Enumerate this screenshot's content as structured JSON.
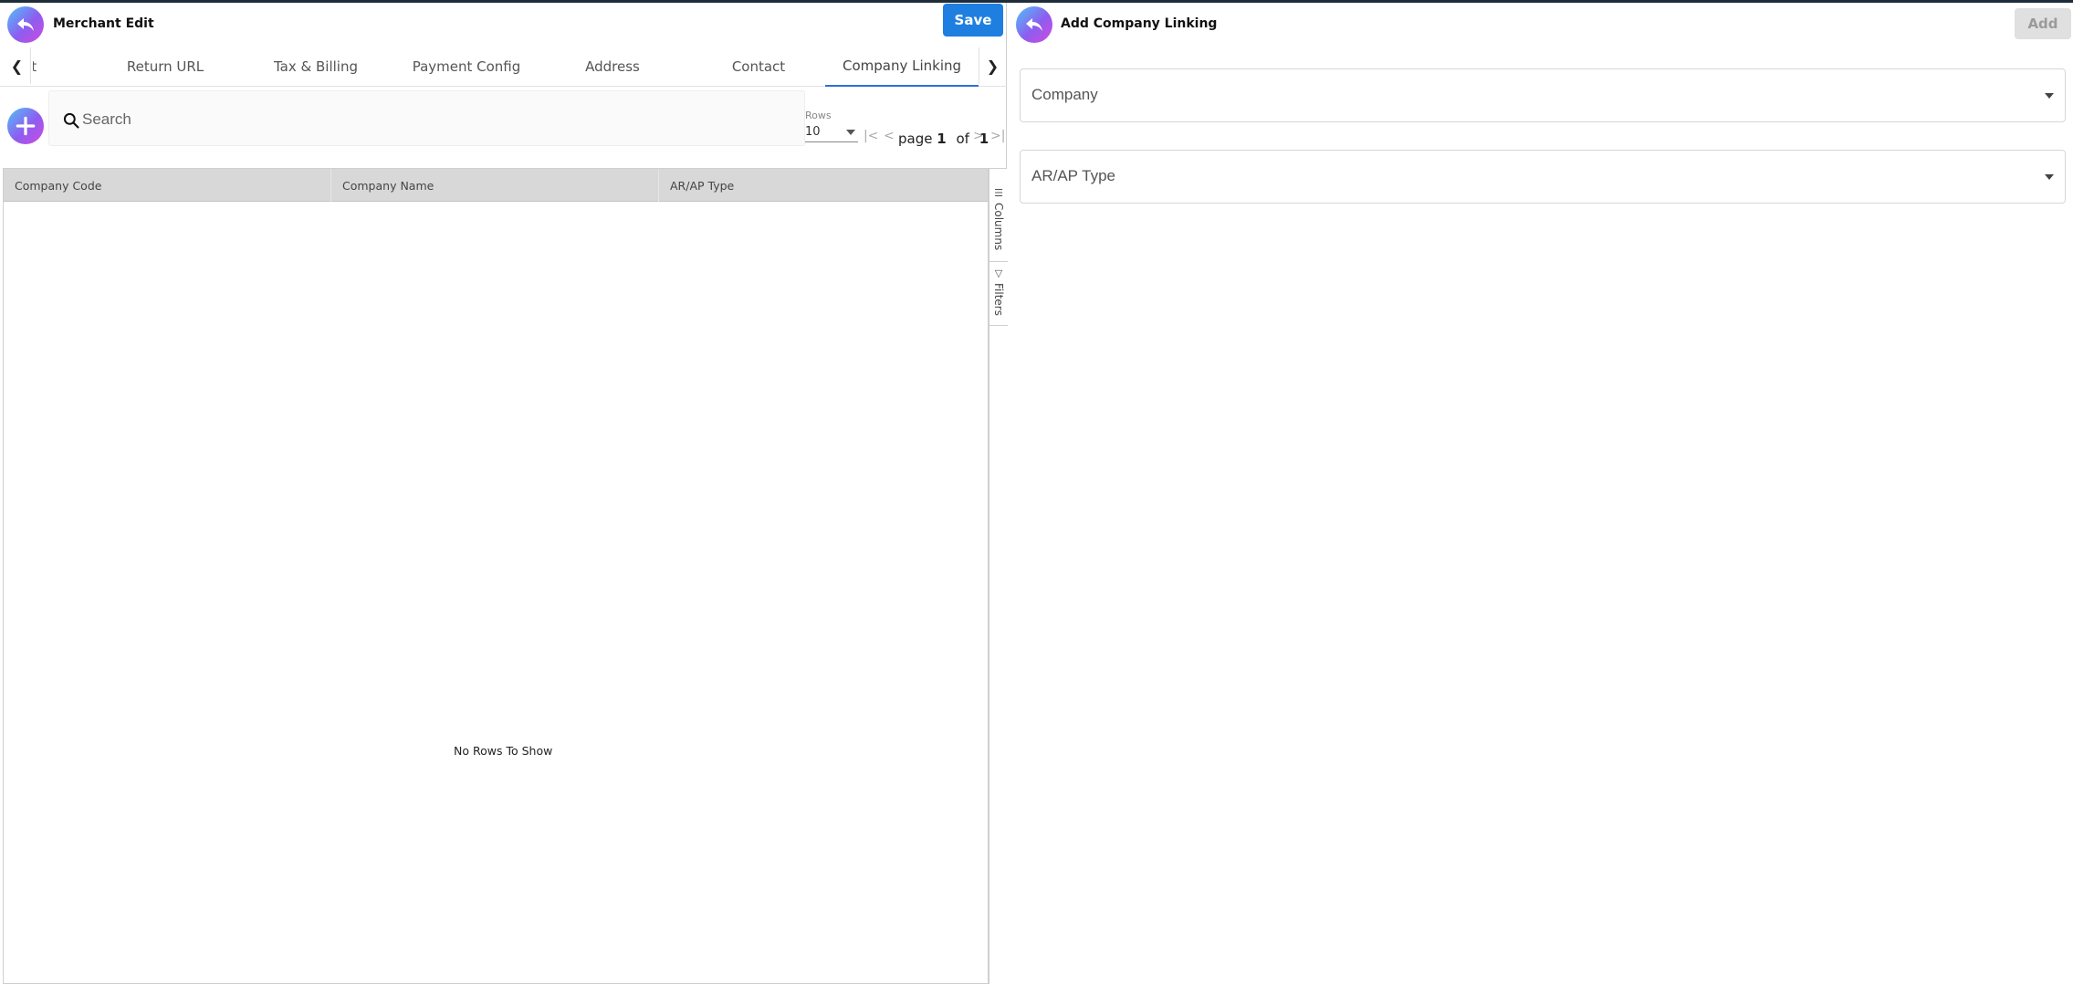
{
  "left_panel": {
    "title": "Merchant Edit",
    "save_label": "Save",
    "tabs": [
      {
        "label": "Contact"
      },
      {
        "label": "Return URL"
      },
      {
        "label": "Tax & Billing"
      },
      {
        "label": "Payment Config"
      },
      {
        "label": "Address"
      },
      {
        "label": "Contact"
      },
      {
        "label": "Company Linking",
        "active": true
      }
    ],
    "search": {
      "placeholder": "Search",
      "value": ""
    },
    "rows": {
      "label": "Rows",
      "value": "10"
    },
    "pager": {
      "prefix": "page",
      "current": "1",
      "of": "of",
      "total": "1"
    },
    "grid": {
      "columns": [
        "Company Code",
        "Company Name",
        "AR/AP Type"
      ],
      "empty_text": "No Rows To Show"
    },
    "side_tabs": {
      "columns": "Columns",
      "filters": "Filters"
    }
  },
  "right_panel": {
    "title": "Add Company Linking",
    "add_label": "Add",
    "fields": [
      {
        "placeholder": "Company"
      },
      {
        "placeholder": "AR/AP Type"
      }
    ]
  },
  "colors": {
    "primary": "#1e7fe0",
    "tab_active": "#2e6fd6",
    "disabled_bg": "#e0e0e0",
    "grid_header": "#d8d8d8"
  },
  "icons": [
    "back-arrow-icon",
    "chevron-left-icon",
    "chevron-right-icon",
    "plus-icon",
    "search-icon",
    "first-page-icon",
    "prev-page-icon",
    "next-page-icon",
    "last-page-icon",
    "columns-icon",
    "filter-icon"
  ]
}
